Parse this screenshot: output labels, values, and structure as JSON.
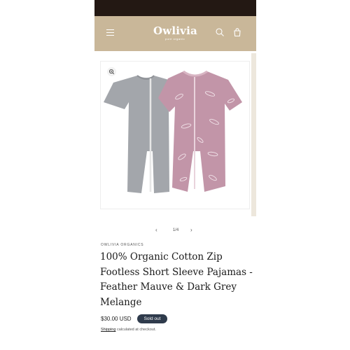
{
  "header": {
    "brand": "Owlivia",
    "tagline": "pure organic",
    "menu_icon": "hamburger-icon",
    "search_icon": "search-icon",
    "cart_icon": "cart-icon",
    "bg_color": "#c9b799",
    "top_bar_color": "#231813"
  },
  "gallery": {
    "zoom_icon": "zoom-in-icon",
    "pager": {
      "prev_icon": "chevron-left-icon",
      "next_icon": "chevron-right-icon",
      "count": "1/4"
    }
  },
  "product": {
    "vendor": "OWLIVIA ORGANICS",
    "title": "100% Organic Cotton Zip Footless Short Sleeve Pajamas - Feather Mauve & Dark Grey Melange",
    "price": "$30.00 USD",
    "badge": "Sold out",
    "badge_color": "#2f3b4c",
    "shipping_link": "Shipping",
    "shipping_note": "calculated at checkout."
  }
}
